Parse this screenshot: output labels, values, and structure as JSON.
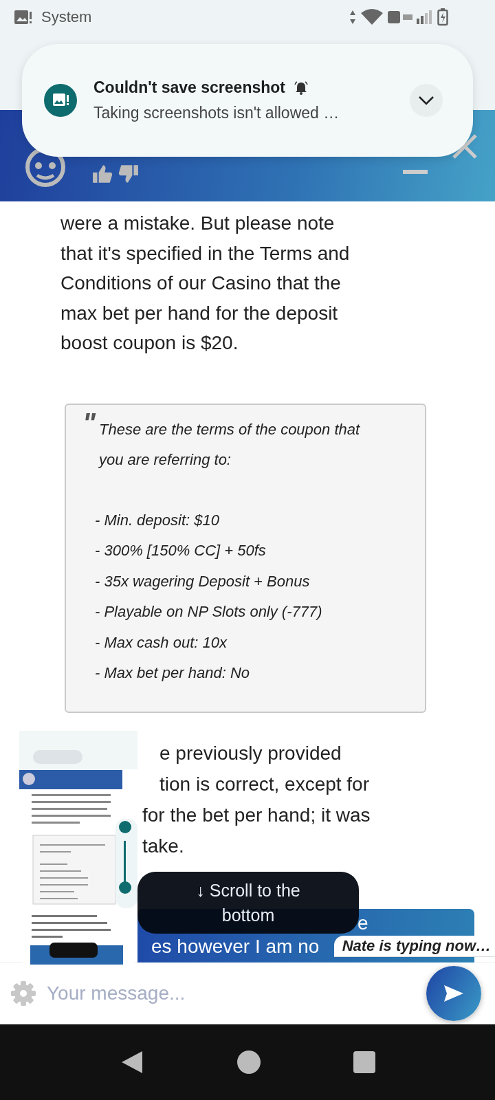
{
  "status_bar": {
    "app_label": "System"
  },
  "notification": {
    "title": "Couldn't save screenshot",
    "text": "Taking screenshots isn't allowed …"
  },
  "agent_message": {
    "lines": [
      "were a mistake. But please note",
      "that it's specified in the Terms and",
      "Conditions of our Casino that the",
      "max bet per hand for the deposit",
      "boost coupon is $20."
    ]
  },
  "quote": {
    "mark": "\"",
    "intro_lines": [
      "These are the terms of the coupon that",
      "you are referring to:"
    ],
    "items": [
      "- Min. deposit: $10",
      "- 300% [150% CC] + 50fs",
      "- 35x wagering Deposit + Bonus",
      "- Playable on NP Slots only (-777)",
      "- Max cash out: 10x",
      "- Max bet per hand: No"
    ]
  },
  "agent_message_2": {
    "lines": [
      {
        "text": "e previously provided",
        "inset": true
      },
      {
        "text": "tion is correct, except for",
        "inset": true
      },
      {
        "text": "for the bet per hand; it was",
        "inset": false
      },
      {
        "text": "take.",
        "inset": false
      }
    ]
  },
  "user_message": {
    "lines": [
      "e",
      "es however I am no"
    ]
  },
  "scroll_button": {
    "label": "↓ Scroll to the bottom"
  },
  "typing_indicator": "Nate is typing now…",
  "composer": {
    "placeholder": "Your message..."
  }
}
